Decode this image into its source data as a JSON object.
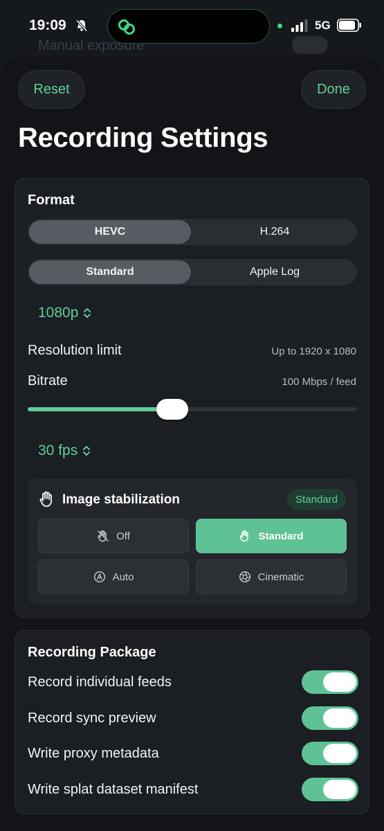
{
  "status_bar": {
    "time": "19:09",
    "network": "5G",
    "silent_icon": "bell-slash-icon",
    "app_icon": "linked-rings-icon"
  },
  "background": {
    "label": "Manual exposure"
  },
  "header": {
    "reset_label": "Reset",
    "done_label": "Done",
    "title": "Recording Settings"
  },
  "format": {
    "title": "Format",
    "codec": {
      "options": [
        "HEVC",
        "H.264"
      ],
      "selected": "HEVC"
    },
    "profile": {
      "options": [
        "Standard",
        "Apple Log"
      ],
      "selected": "Standard"
    },
    "resolution_picker": "1080p",
    "resolution_limit_label": "Resolution limit",
    "resolution_limit_value": "Up to 1920 x 1080",
    "bitrate_label": "Bitrate",
    "bitrate_value": "100 Mbps / feed",
    "bitrate_slider_fraction": 0.44,
    "fps_picker": "30 fps",
    "stabilization": {
      "title": "Image stabilization",
      "badge": "Standard",
      "options": [
        {
          "label": "Off",
          "icon": "hand-slash-icon",
          "selected": false
        },
        {
          "label": "Standard",
          "icon": "hand-raised-icon",
          "selected": true
        },
        {
          "label": "Auto",
          "icon": "circle-a-icon",
          "selected": false
        },
        {
          "label": "Cinematic",
          "icon": "aperture-icon",
          "selected": false
        }
      ]
    }
  },
  "package": {
    "title": "Recording Package",
    "toggles": [
      {
        "label": "Record individual feeds",
        "on": true
      },
      {
        "label": "Record sync preview",
        "on": true
      },
      {
        "label": "Write proxy metadata",
        "on": true
      },
      {
        "label": "Write splat dataset manifest",
        "on": true
      }
    ]
  },
  "colors": {
    "accent": "#5fcf99",
    "accent_fill": "#5fc295",
    "background": "#121417",
    "card": "#1b1e22"
  }
}
